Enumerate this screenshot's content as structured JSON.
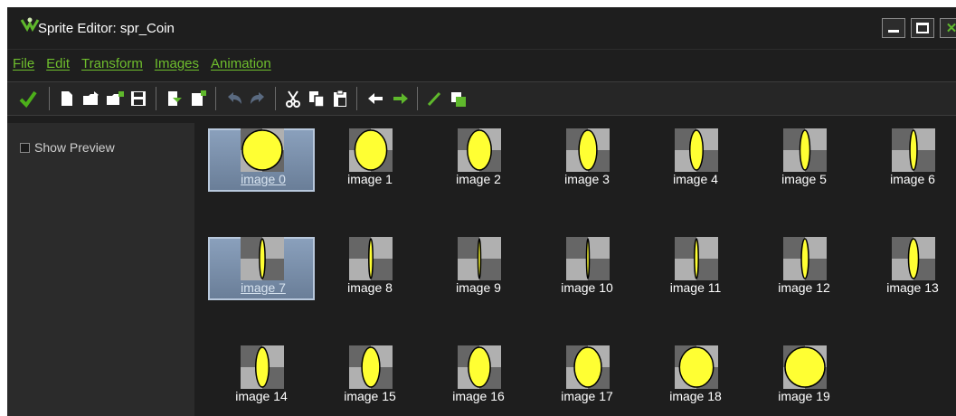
{
  "window": {
    "title": "Sprite Editor: spr_Coin",
    "icon": "gamemaker-logo-icon",
    "controls": [
      "minimize-icon",
      "maximize-icon",
      "close-icon"
    ]
  },
  "menu": [
    {
      "label": "File"
    },
    {
      "label": "Edit"
    },
    {
      "label": "Transform"
    },
    {
      "label": "Images"
    },
    {
      "label": "Animation"
    }
  ],
  "toolbar": [
    {
      "icon": "confirm-check-icon"
    },
    {
      "icon": "new-file-icon"
    },
    {
      "icon": "open-folder-icon"
    },
    {
      "icon": "add-from-file-icon"
    },
    {
      "icon": "save-icon"
    },
    {
      "icon": "import-icon"
    },
    {
      "icon": "new-image-icon"
    },
    {
      "icon": "undo-icon"
    },
    {
      "icon": "redo-icon"
    },
    {
      "icon": "cut-icon"
    },
    {
      "icon": "copy-icon"
    },
    {
      "icon": "paste-icon"
    },
    {
      "icon": "arrow-left-icon"
    },
    {
      "icon": "arrow-right-icon"
    },
    {
      "icon": "edit-pencil-icon"
    },
    {
      "icon": "layers-icon"
    }
  ],
  "preview": {
    "label": "Show Preview",
    "checked": false
  },
  "colors": {
    "coin_fill": "#ffff33",
    "coin_outline": "#000000",
    "menu_accent": "#6fbf2d",
    "selection": "#8aa0bc"
  },
  "images": [
    {
      "label": "image 0",
      "selected": true,
      "coin_width": 1.0
    },
    {
      "label": "image 1",
      "selected": false,
      "coin_width": 0.8
    },
    {
      "label": "image 2",
      "selected": false,
      "coin_width": 0.6
    },
    {
      "label": "image 3",
      "selected": false,
      "coin_width": 0.45
    },
    {
      "label": "image 4",
      "selected": false,
      "coin_width": 0.33
    },
    {
      "label": "image 5",
      "selected": false,
      "coin_width": 0.25
    },
    {
      "label": "image 6",
      "selected": false,
      "coin_width": 0.18
    },
    {
      "label": "image 7",
      "selected": true,
      "coin_width": 0.14
    },
    {
      "label": "image 8",
      "selected": false,
      "coin_width": 0.1
    },
    {
      "label": "image 9",
      "selected": false,
      "coin_width": 0.05
    },
    {
      "label": "image 10",
      "selected": false,
      "coin_width": 0.05
    },
    {
      "label": "image 11",
      "selected": false,
      "coin_width": 0.1
    },
    {
      "label": "image 12",
      "selected": false,
      "coin_width": 0.18
    },
    {
      "label": "image 13",
      "selected": false,
      "coin_width": 0.25
    },
    {
      "label": "image 14",
      "selected": false,
      "coin_width": 0.33
    },
    {
      "label": "image 15",
      "selected": false,
      "coin_width": 0.45
    },
    {
      "label": "image 16",
      "selected": false,
      "coin_width": 0.55
    },
    {
      "label": "image 17",
      "selected": false,
      "coin_width": 0.68
    },
    {
      "label": "image 18",
      "selected": false,
      "coin_width": 0.85
    },
    {
      "label": "image 19",
      "selected": false,
      "coin_width": 1.0
    }
  ]
}
